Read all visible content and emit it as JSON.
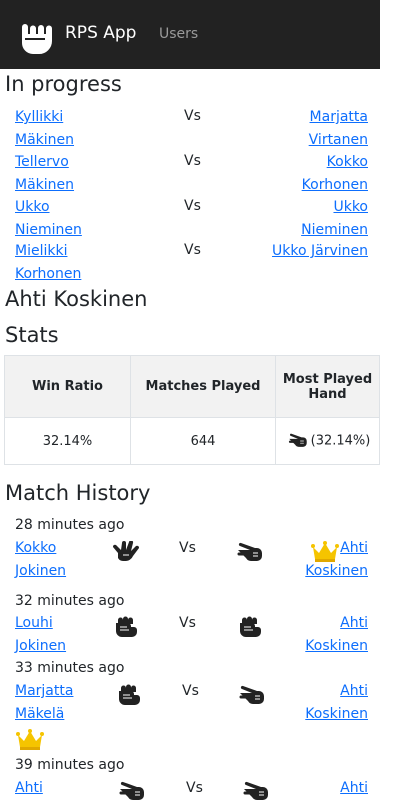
{
  "nav": {
    "brand": "RPS App",
    "users_link": "Users",
    "icon": "fist-icon"
  },
  "in_progress": {
    "title": "In progress",
    "matches": [
      {
        "left": [
          "Kyllikki",
          "Mäkinen"
        ],
        "vs": "Vs",
        "right": [
          "Marjatta",
          "Virtanen"
        ]
      },
      {
        "left": [
          "Tellervo",
          "Mäkinen"
        ],
        "vs": "Vs",
        "right": [
          "Kokko",
          "Korhonen"
        ]
      },
      {
        "left": [
          "Ukko",
          "Nieminen"
        ],
        "vs": "Vs",
        "right": [
          "Ukko",
          "Nieminen"
        ]
      },
      {
        "left": [
          "Mielikki",
          "Korhonen"
        ],
        "vs": "Vs",
        "right": [
          "Ukko Järvinen"
        ]
      }
    ]
  },
  "player": {
    "name": "Ahti Koskinen"
  },
  "stats": {
    "title": "Stats",
    "headers": [
      "Win Ratio",
      "Matches Played",
      "Most Played Hand"
    ],
    "win_ratio": "32.14%",
    "matches_played": "644",
    "most_played_hand": "(32.14%)",
    "most_played_hand_icon": "scissors-icon"
  },
  "history": {
    "title": "Match History",
    "entries": [
      {
        "time": "28 minutes ago",
        "left": [
          "Kokko",
          "Jokinen"
        ],
        "left_hand": "paper",
        "vs": "Vs",
        "right_hand": "scissors",
        "right": [
          "Ahti",
          "Koskinen"
        ],
        "winner": "right"
      },
      {
        "time": "32 minutes ago",
        "left": [
          "Louhi",
          "Jokinen"
        ],
        "left_hand": "rock",
        "vs": "Vs",
        "right_hand": "rock",
        "right": [
          "Ahti",
          "Koskinen"
        ],
        "winner": "none"
      },
      {
        "time": "33 minutes ago",
        "left": [
          "Marjatta",
          "Mäkelä"
        ],
        "left_hand": "rock",
        "vs": "Vs",
        "right_hand": "scissors",
        "right": [
          "Ahti",
          "Koskinen"
        ],
        "winner": "left"
      },
      {
        "time": "39 minutes ago",
        "left": [
          "Ahti"
        ],
        "left_hand": "scissors",
        "vs": "Vs",
        "right_hand": "scissors",
        "right": [
          "Ahti"
        ],
        "winner": "none"
      }
    ]
  },
  "colors": {
    "link": "#0d6efd",
    "navbar": "#222222",
    "crown": "#f5c400"
  }
}
